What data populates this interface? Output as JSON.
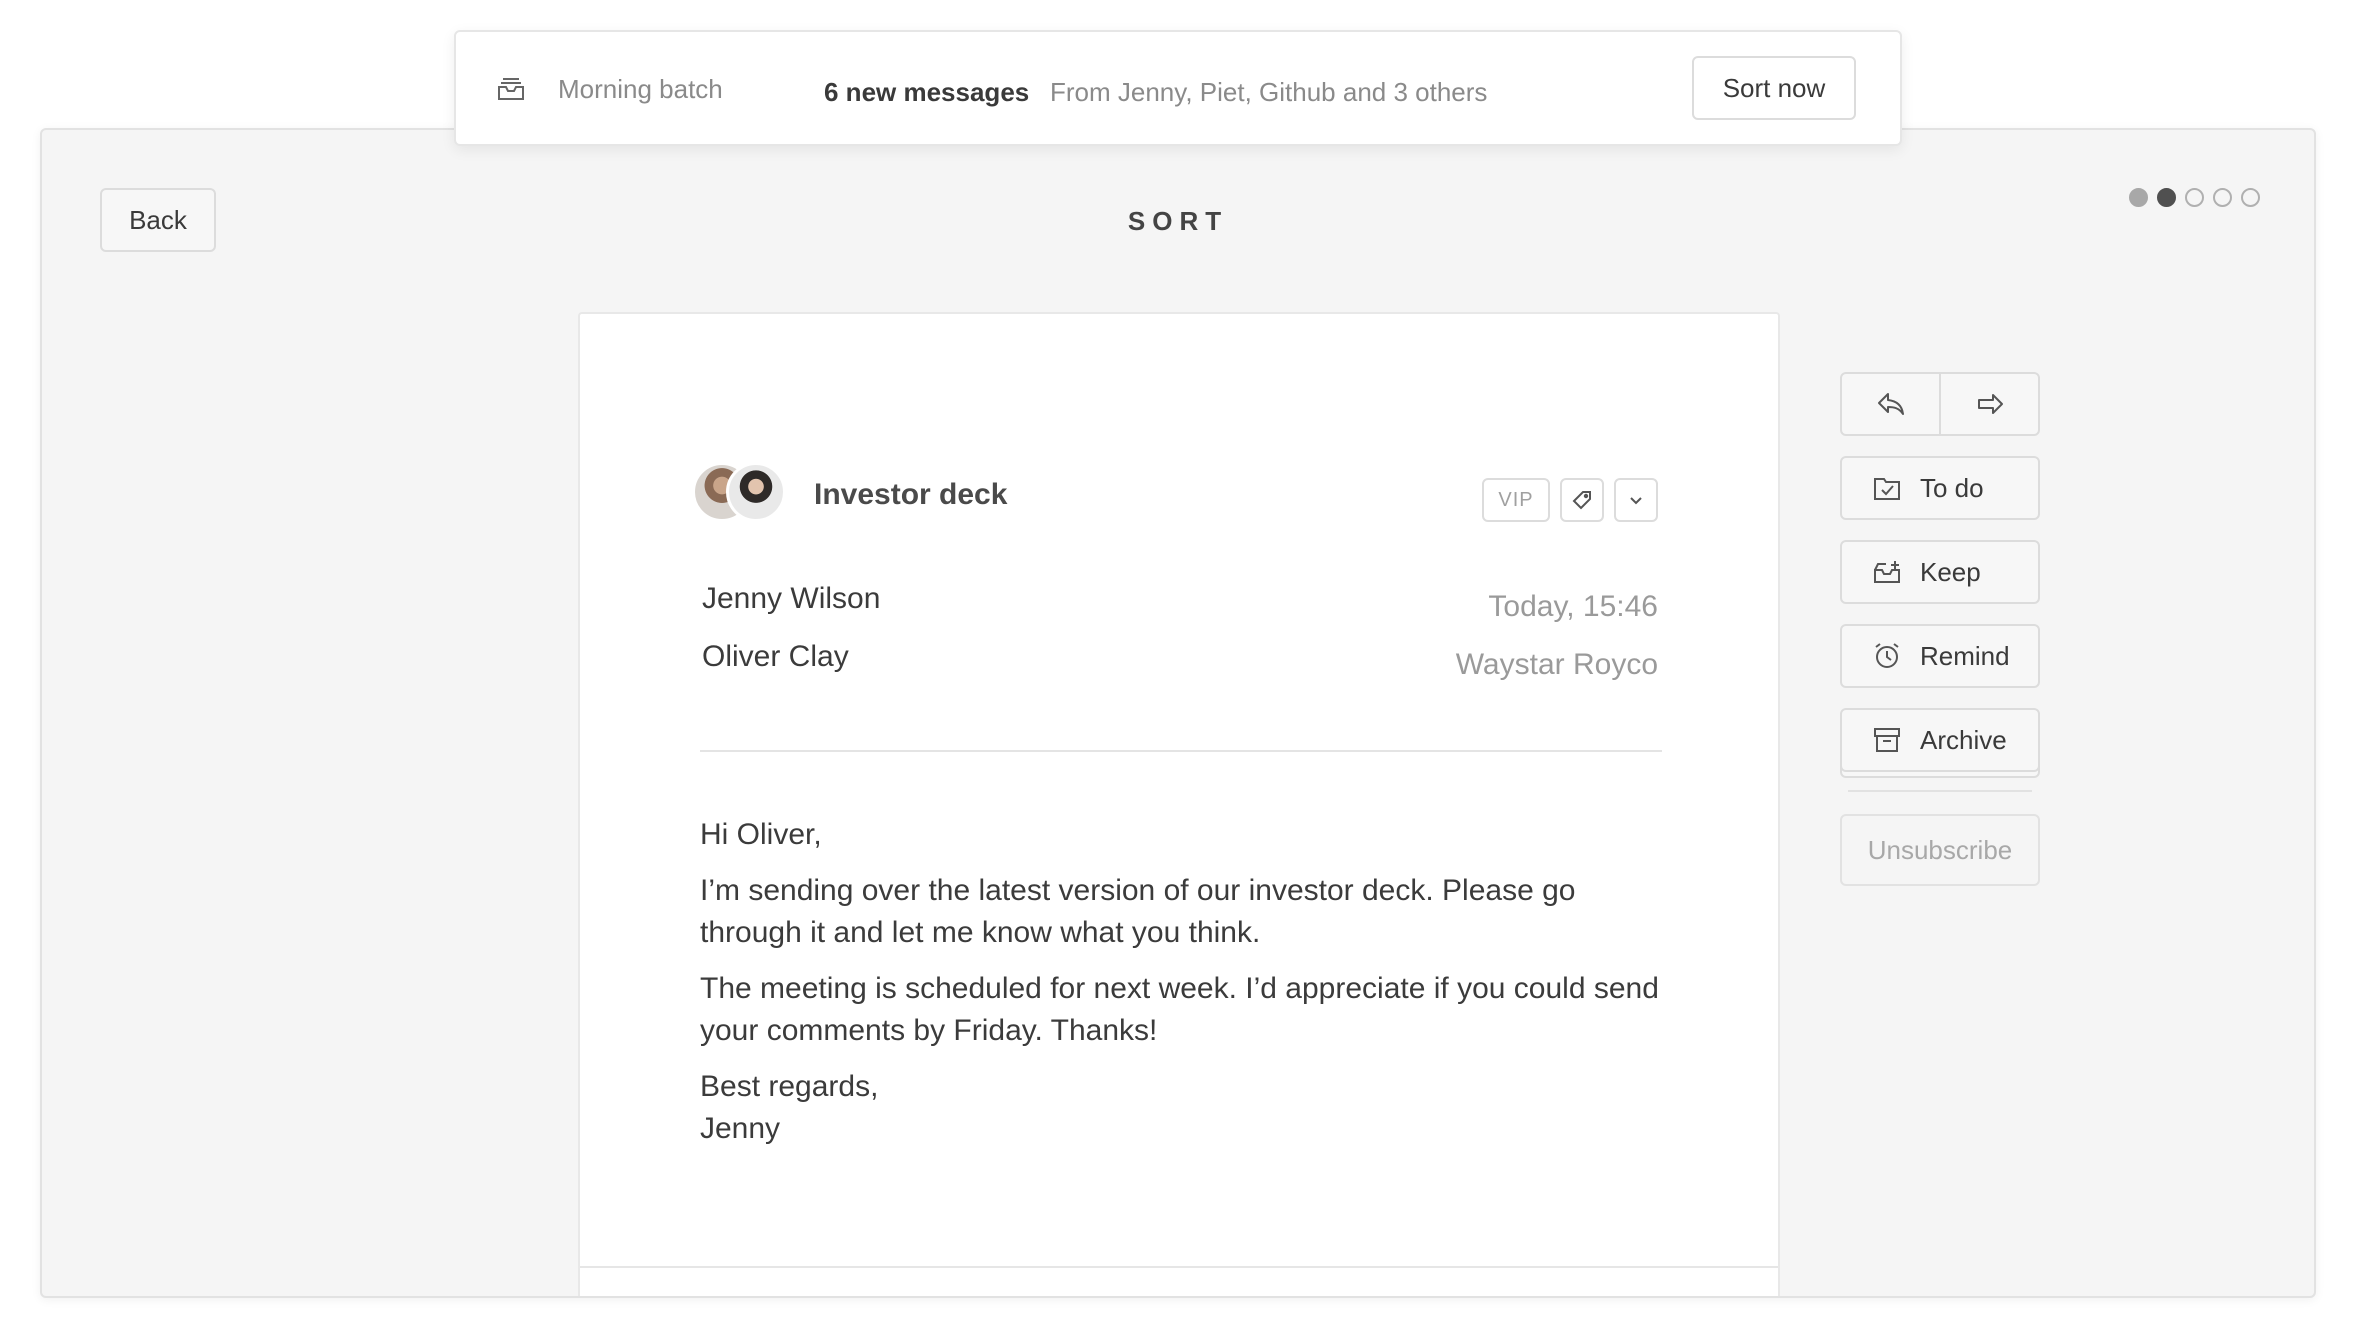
{
  "notification": {
    "batch_label": "Morning batch",
    "count": "6 new messages",
    "from": "From Jenny, Piet, Github and 3 others",
    "sort_now": "Sort now"
  },
  "header": {
    "back": "Back",
    "title": "SORT",
    "progress": {
      "total": 5,
      "current": 2
    }
  },
  "email": {
    "subject": "Investor deck",
    "vip_label": "VIP",
    "from_name": "Jenny Wilson",
    "to_name": "Oliver Clay",
    "time": "Today, 15:46",
    "company": "Waystar Royco",
    "body": {
      "greeting": "Hi Oliver,",
      "p1": "I’m sending over the latest version of our investor deck. Please go through it and let me know what you think.",
      "p2": "The meeting is scheduled for next week. I’d appreciate if you could send your comments by Friday. Thanks!",
      "closing": "Best regards,",
      "signature": "Jenny"
    }
  },
  "actions": {
    "todo": "To do",
    "keep": "Keep",
    "remind": "Remind",
    "archive": "Archive",
    "unsubscribe": "Unsubscribe"
  }
}
